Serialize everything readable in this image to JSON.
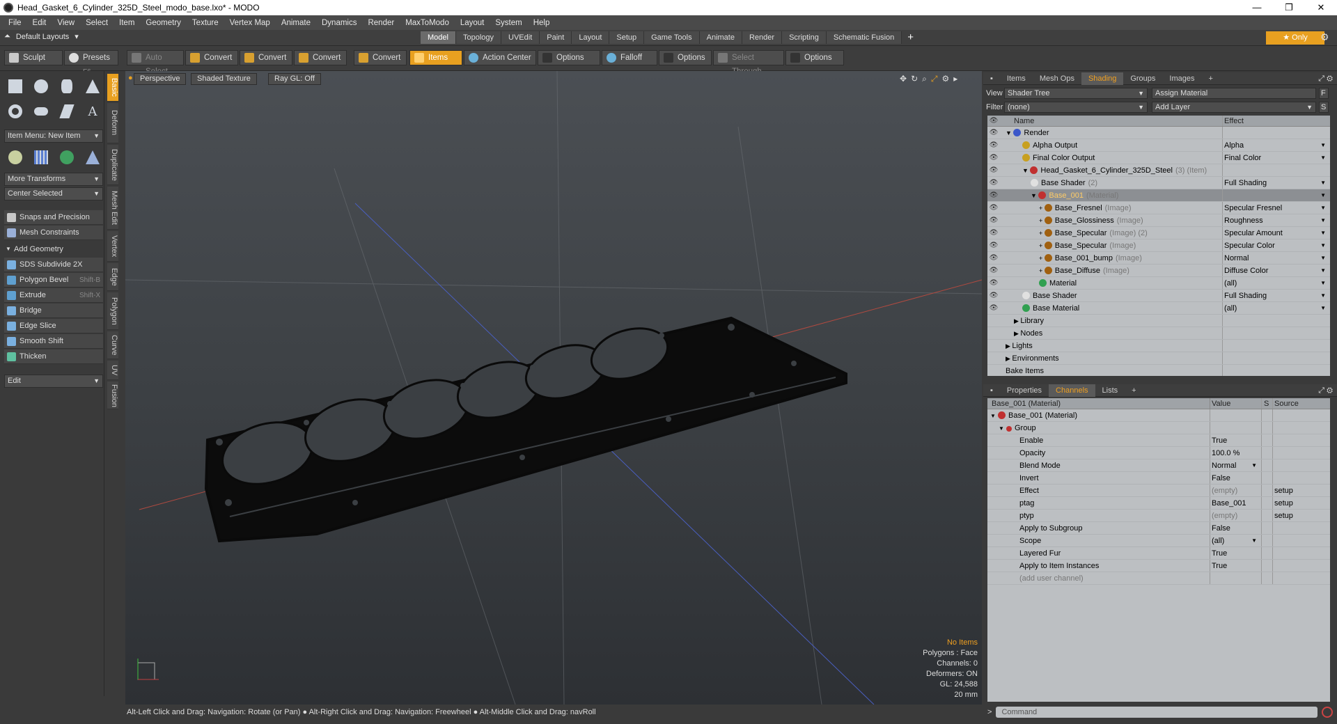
{
  "window": {
    "title": "Head_Gasket_6_Cylinder_325D_Steel_modo_base.lxo* - MODO"
  },
  "menu": [
    "File",
    "Edit",
    "View",
    "Select",
    "Item",
    "Geometry",
    "Texture",
    "Vertex Map",
    "Animate",
    "Dynamics",
    "Render",
    "MaxToModo",
    "Layout",
    "System",
    "Help"
  ],
  "layouts": {
    "default_label": "Default Layouts",
    "tabs": [
      "Model",
      "Topology",
      "UVEdit",
      "Paint",
      "Layout",
      "Setup",
      "Game Tools",
      "Animate",
      "Render",
      "Scripting",
      "Schematic Fusion"
    ],
    "active_tab": "Model",
    "only_label": "Only"
  },
  "toolbar": {
    "sculpt": "Sculpt",
    "presets": "Presets",
    "presets_key": "F6",
    "auto_select": "Auto Select",
    "convert1": "Convert",
    "convert2": "Convert",
    "convert3": "Convert",
    "convert4": "Convert",
    "items": "Items",
    "action_center": "Action Center",
    "options1": "Options",
    "falloff": "Falloff",
    "options2": "Options",
    "select_through": "Select Through",
    "options3": "Options"
  },
  "left_panel": {
    "item_menu": "Item Menu: New Item",
    "more_transforms": "More Transforms",
    "center_selected": "Center Selected",
    "snaps": "Snaps and Precision",
    "mesh_constraints": "Mesh Constraints",
    "add_geometry": "Add Geometry",
    "tools": [
      {
        "label": "SDS Subdivide 2X",
        "shortcut": ""
      },
      {
        "label": "Polygon Bevel",
        "shortcut": "Shift-B"
      },
      {
        "label": "Extrude",
        "shortcut": "Shift-X"
      },
      {
        "label": "Bridge",
        "shortcut": ""
      },
      {
        "label": "Edge Slice",
        "shortcut": ""
      },
      {
        "label": "Smooth Shift",
        "shortcut": ""
      },
      {
        "label": "Thicken",
        "shortcut": ""
      }
    ],
    "edit": "Edit",
    "vertical_tabs": [
      "Basic",
      "Deform",
      "Duplicate",
      "Mesh Edit",
      "Vertex",
      "Edge",
      "Polygon",
      "Curve",
      "UV",
      "Fusion"
    ]
  },
  "viewport": {
    "perspective": "Perspective",
    "shaded_texture": "Shaded Texture",
    "ray_gl": "Ray GL: Off",
    "stats": {
      "no_items": "No Items",
      "polygons": "Polygons : Face",
      "channels": "Channels: 0",
      "deformers": "Deformers: ON",
      "gl": "GL: 24,588",
      "scale": "20 mm"
    }
  },
  "status_bar": "Alt-Left Click and Drag: Navigation: Rotate (or Pan) ● Alt-Right Click and Drag: Navigation: Freewheel ● Alt-Middle Click and Drag: navRoll",
  "shading_panel": {
    "tabs": [
      "Items",
      "Mesh Ops",
      "Shading",
      "Groups",
      "Images"
    ],
    "active_tab": "Shading",
    "view_label": "View",
    "view_value": "Shader Tree",
    "assign_material": "Assign Material",
    "filter_label": "Filter",
    "filter_value": "(none)",
    "add_layer": "Add Layer",
    "col_name": "Name",
    "col_effect": "Effect",
    "rows": [
      {
        "name": "Render",
        "extra": "",
        "effect": "",
        "depth": 0,
        "eye": true,
        "dot": "#3b57c9",
        "expand": "▼"
      },
      {
        "name": "Alpha Output",
        "extra": "",
        "effect": "Alpha",
        "depth": 2,
        "eye": true,
        "dot": "#c8a020",
        "expand": ""
      },
      {
        "name": "Final Color Output",
        "extra": "",
        "effect": "Final Color",
        "depth": 2,
        "eye": true,
        "dot": "#c8a020",
        "expand": ""
      },
      {
        "name": "Head_Gasket_6_Cylinder_325D_Steel",
        "extra": "(3) (Item)",
        "effect": "",
        "depth": 2,
        "eye": true,
        "dot": "#c03030",
        "expand": "▼"
      },
      {
        "name": "Base Shader",
        "extra": "(2)",
        "effect": "Full Shading",
        "depth": 3,
        "eye": true,
        "dot": "#e0e0e0",
        "expand": ""
      },
      {
        "name": "Base_001",
        "extra": "(Material)",
        "effect": "",
        "depth": 3,
        "eye": true,
        "dot": "#c03030",
        "expand": "▼",
        "selected": true
      },
      {
        "name": "Base_Fresnel",
        "extra": "(Image)",
        "effect": "Specular Fresnel",
        "depth": 4,
        "eye": true,
        "dot": "#a06010",
        "expand": "+"
      },
      {
        "name": "Base_Glossiness",
        "extra": "(Image)",
        "effect": "Roughness",
        "depth": 4,
        "eye": true,
        "dot": "#a06010",
        "expand": "+"
      },
      {
        "name": "Base_Specular",
        "extra": "(Image) (2)",
        "effect": "Specular Amount",
        "depth": 4,
        "eye": true,
        "dot": "#a06010",
        "expand": "+"
      },
      {
        "name": "Base_Specular",
        "extra": "(Image)",
        "effect": "Specular Color",
        "depth": 4,
        "eye": true,
        "dot": "#a06010",
        "expand": "+"
      },
      {
        "name": "Base_001_bump",
        "extra": "(Image)",
        "effect": "Normal",
        "depth": 4,
        "eye": true,
        "dot": "#a06010",
        "expand": "+"
      },
      {
        "name": "Base_Diffuse",
        "extra": "(Image)",
        "effect": "Diffuse Color",
        "depth": 4,
        "eye": true,
        "dot": "#a06010",
        "expand": "+"
      },
      {
        "name": "Material",
        "extra": "",
        "effect": "(all)",
        "depth": 4,
        "eye": true,
        "dot": "#30a050",
        "expand": ""
      },
      {
        "name": "Base Shader",
        "extra": "",
        "effect": "Full Shading",
        "depth": 2,
        "eye": true,
        "dot": "#e0e0e0",
        "expand": ""
      },
      {
        "name": "Base Material",
        "extra": "",
        "effect": "(all)",
        "depth": 2,
        "eye": true,
        "dot": "#30a050",
        "expand": ""
      },
      {
        "name": "Library",
        "extra": "",
        "effect": "",
        "depth": 1,
        "eye": false,
        "dot": "",
        "expand": "▶"
      },
      {
        "name": "Nodes",
        "extra": "",
        "effect": "",
        "depth": 1,
        "eye": false,
        "dot": "",
        "expand": "▶"
      },
      {
        "name": "Lights",
        "extra": "",
        "effect": "",
        "depth": 0,
        "eye": false,
        "dot": "",
        "expand": "▶"
      },
      {
        "name": "Environments",
        "extra": "",
        "effect": "",
        "depth": 0,
        "eye": false,
        "dot": "",
        "expand": "▶"
      },
      {
        "name": "Bake Items",
        "extra": "",
        "effect": "",
        "depth": 0,
        "eye": false,
        "dot": "",
        "expand": ""
      }
    ]
  },
  "channels_panel": {
    "tabs": [
      "Properties",
      "Channels",
      "Lists"
    ],
    "active_tab": "Channels",
    "header_name": "Base_001 (Material)",
    "col_value": "Value",
    "col_s": "S",
    "col_source": "Source",
    "root": "Base_001 (Material)",
    "group": "Group",
    "rows": [
      {
        "name": "Enable",
        "value": "True",
        "source": "",
        "dim": false,
        "dd": false
      },
      {
        "name": "Opacity",
        "value": "100.0 %",
        "source": "",
        "dim": false,
        "dd": false
      },
      {
        "name": "Blend Mode",
        "value": "Normal",
        "source": "",
        "dim": false,
        "dd": true
      },
      {
        "name": "Invert",
        "value": "False",
        "source": "",
        "dim": false,
        "dd": false
      },
      {
        "name": "Effect",
        "value": "(empty)",
        "source": "setup",
        "dim": true,
        "dd": false
      },
      {
        "name": "ptag",
        "value": "Base_001",
        "source": "setup",
        "dim": false,
        "dd": false
      },
      {
        "name": "ptyp",
        "value": "(empty)",
        "source": "setup",
        "dim": true,
        "dd": false
      },
      {
        "name": "Apply to Subgroup",
        "value": "False",
        "source": "",
        "dim": false,
        "dd": false
      },
      {
        "name": "Scope",
        "value": "(all)",
        "source": "",
        "dim": false,
        "dd": true
      },
      {
        "name": "Layered Fur",
        "value": "True",
        "source": "",
        "dim": false,
        "dd": false
      },
      {
        "name": "Apply to Item Instances",
        "value": "True",
        "source": "",
        "dim": false,
        "dd": false
      }
    ],
    "add_user_channel": "(add user channel)"
  },
  "command": {
    "placeholder": "Command"
  }
}
